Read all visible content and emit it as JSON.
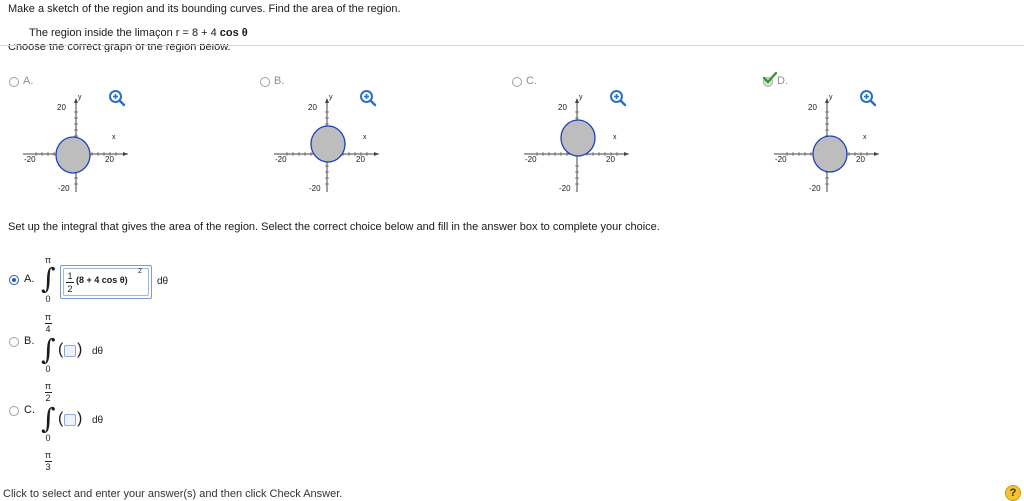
{
  "question": "Make a sketch of the region and its bounding curves. Find the area of the region.",
  "given_prefix": "The region inside the limaçon r = 8 + 4",
  "given_func": "cos θ",
  "choose_prompt": "Choose the correct graph of the region below.",
  "graph_options": [
    {
      "label": "A.",
      "selected": false,
      "correct": false
    },
    {
      "label": "B.",
      "selected": false,
      "correct": false
    },
    {
      "label": "C.",
      "selected": false,
      "correct": false
    },
    {
      "label": "D.",
      "selected": true,
      "correct": true
    }
  ],
  "graph_axes": {
    "y_label": "y",
    "x_label": "x",
    "y_top": "20",
    "y_bottom": "-20",
    "x_left": "-20",
    "x_right": "20"
  },
  "setup_prompt": "Set up the integral that gives the area of the region. Select the correct choice below and fill in the answer box to complete your choice.",
  "integral_options": [
    {
      "label": "A.",
      "selected": true,
      "upper": "π",
      "lower": "0",
      "frac_num": "1",
      "frac_den": "2",
      "expression": "(8 + 4 cos θ)",
      "exponent": "2",
      "differential": "dθ"
    },
    {
      "label": "B.",
      "selected": false,
      "upper": "π/4",
      "upper_num": "π",
      "upper_den": "4",
      "lower": "0",
      "differential": "dθ"
    },
    {
      "label": "C.",
      "selected": false,
      "upper": "π/2",
      "upper_num": "π",
      "upper_den": "2",
      "lower": "0",
      "differential": "dθ"
    }
  ],
  "extra_limit": {
    "num": "π",
    "den": "3"
  },
  "footer": "Click to select and enter your answer(s) and then click Check Answer.",
  "help_label": "?",
  "colors": {
    "accent": "#2a5db0",
    "region_fill": "#bdbdbd",
    "curve": "#1f3fbf",
    "correct_check": "#2e9b2e"
  }
}
